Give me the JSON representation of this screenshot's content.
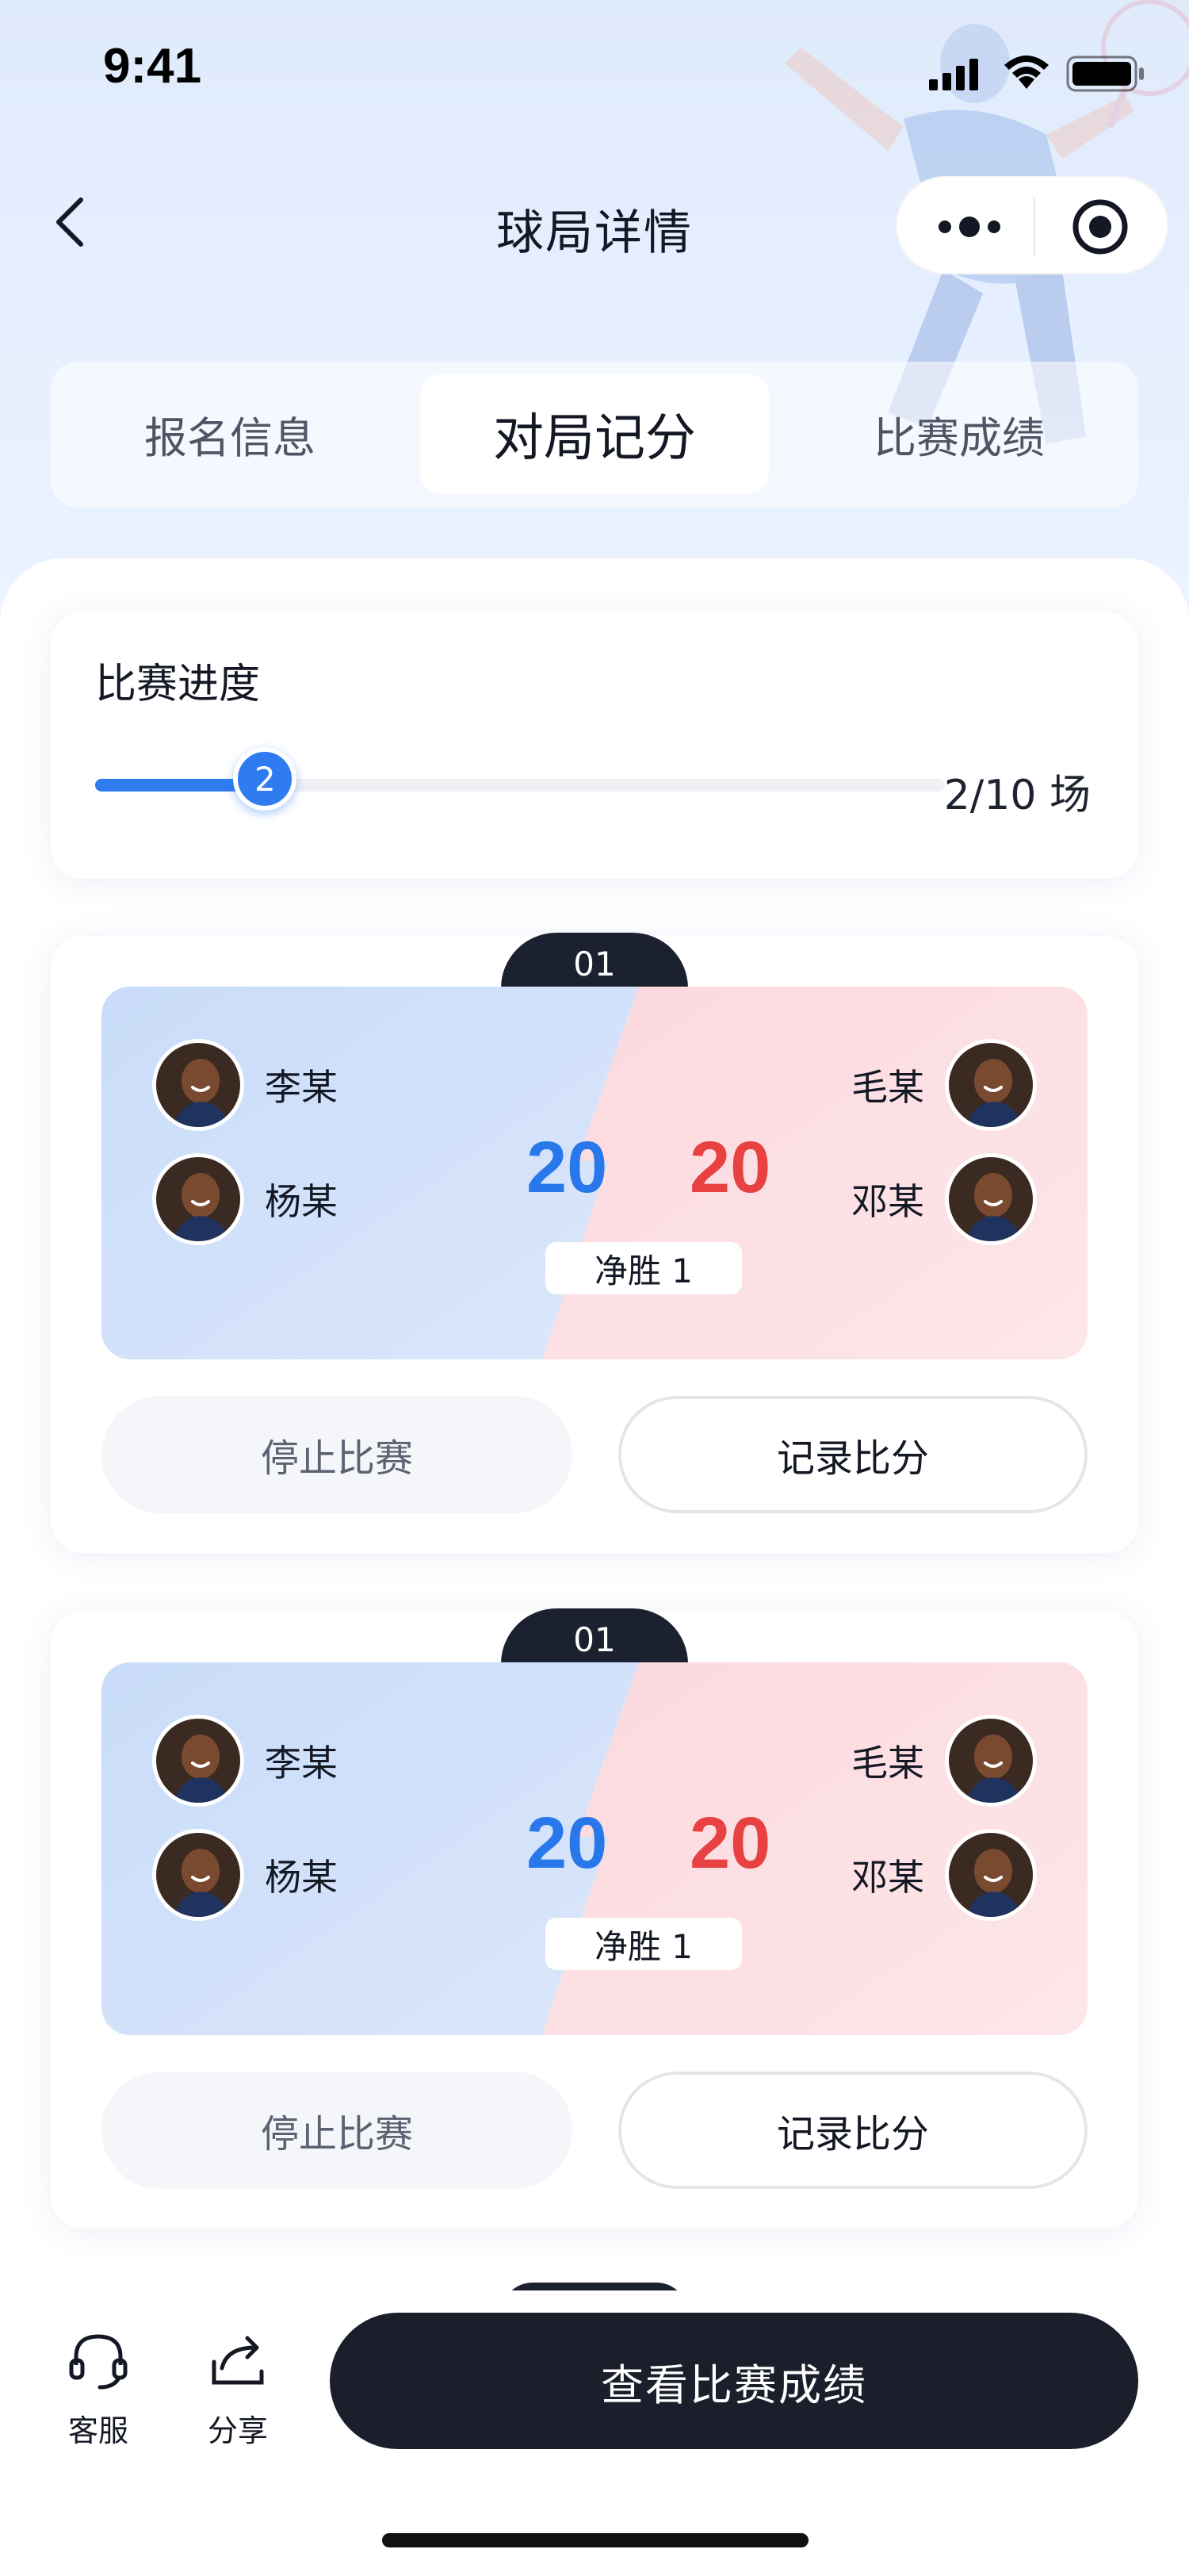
{
  "status_bar": {
    "time": "9:41"
  },
  "nav": {
    "title": "球局详情"
  },
  "tabs": [
    {
      "label": "报名信息",
      "active": false
    },
    {
      "label": "对局记分",
      "active": true
    },
    {
      "label": "比赛成绩",
      "active": false
    }
  ],
  "progress": {
    "title": "比赛进度",
    "current": "2",
    "count_text": "2/10 场",
    "fraction": 0.2
  },
  "matches": [
    {
      "number": "01",
      "team_left": [
        {
          "name": "李某"
        },
        {
          "name": "杨某"
        }
      ],
      "team_right": [
        {
          "name": "毛某"
        },
        {
          "name": "邓某"
        }
      ],
      "score_left": "20",
      "score_right": "20",
      "net_win": "净胜 1",
      "stop_label": "停止比赛",
      "record_label": "记录比分"
    },
    {
      "number": "01",
      "team_left": [
        {
          "name": "李某"
        },
        {
          "name": "杨某"
        }
      ],
      "team_right": [
        {
          "name": "毛某"
        },
        {
          "name": "邓某"
        }
      ],
      "score_left": "20",
      "score_right": "20",
      "net_win": "净胜 1",
      "stop_label": "停止比赛",
      "record_label": "记录比分"
    }
  ],
  "bottom_bar": {
    "service_label": "客服",
    "share_label": "分享",
    "primary_label": "查看比赛成绩"
  },
  "colors": {
    "accent_blue": "#2f7bf0",
    "score_blue": "#2878ec",
    "score_red": "#e84141",
    "dark": "#1b1f2c"
  },
  "icons": [
    "back-icon",
    "more-icon",
    "target-icon",
    "headset-icon",
    "share-icon",
    "signal-icon",
    "wifi-icon",
    "battery-icon"
  ]
}
